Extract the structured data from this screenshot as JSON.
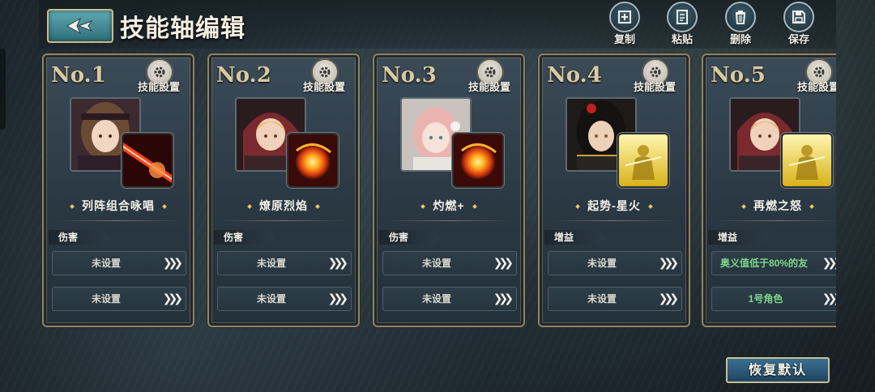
{
  "header": {
    "title": "技能轴编辑",
    "tools": [
      {
        "label": "复制",
        "icon": "copy-icon"
      },
      {
        "label": "粘贴",
        "icon": "paste-icon"
      },
      {
        "label": "删除",
        "icon": "trash-icon"
      },
      {
        "label": "保存",
        "icon": "save-icon"
      }
    ]
  },
  "cards": [
    {
      "no": "No.1",
      "settings_label": "技能設置",
      "skill_name": "列阵组合咏唱",
      "type": "伤害",
      "slot1": "未设置",
      "slot2": "未设置",
      "portrait": "brown-haired-mage-portrait",
      "skill_icon": "red-beam-skill-icon"
    },
    {
      "no": "No.2",
      "settings_label": "技能設置",
      "skill_name": "燎原烈焰",
      "type": "伤害",
      "slot1": "未设置",
      "slot2": "未设置",
      "portrait": "blonde-hooded-character-portrait",
      "skill_icon": "fireball-skill-icon"
    },
    {
      "no": "No.3",
      "settings_label": "技能設置",
      "skill_name": "灼燃+",
      "type": "伤害",
      "slot1": "未设置",
      "slot2": "未设置",
      "portrait": "pink-haired-girl-portrait",
      "skill_icon": "fireball-skill-icon"
    },
    {
      "no": "No.4",
      "settings_label": "技能設置",
      "skill_name": "起势-星火",
      "type": "增益",
      "slot1": "未设置",
      "slot2": "未设置",
      "portrait": "black-haired-swordsman-portrait",
      "skill_icon": "golden-buff-skill-icon"
    },
    {
      "no": "No.5",
      "settings_label": "技能設置",
      "skill_name": "再燃之怒",
      "type": "增益",
      "slot1": "奥义值低于80%的友",
      "slot2": "1号角色",
      "portrait": "blonde-hooded-character-portrait",
      "skill_icon": "golden-buff-skill-icon"
    }
  ],
  "restore_label": "恢复默认",
  "colors": {
    "accent_gold": "#c8bd94",
    "condition_green": "#7fd68a"
  }
}
